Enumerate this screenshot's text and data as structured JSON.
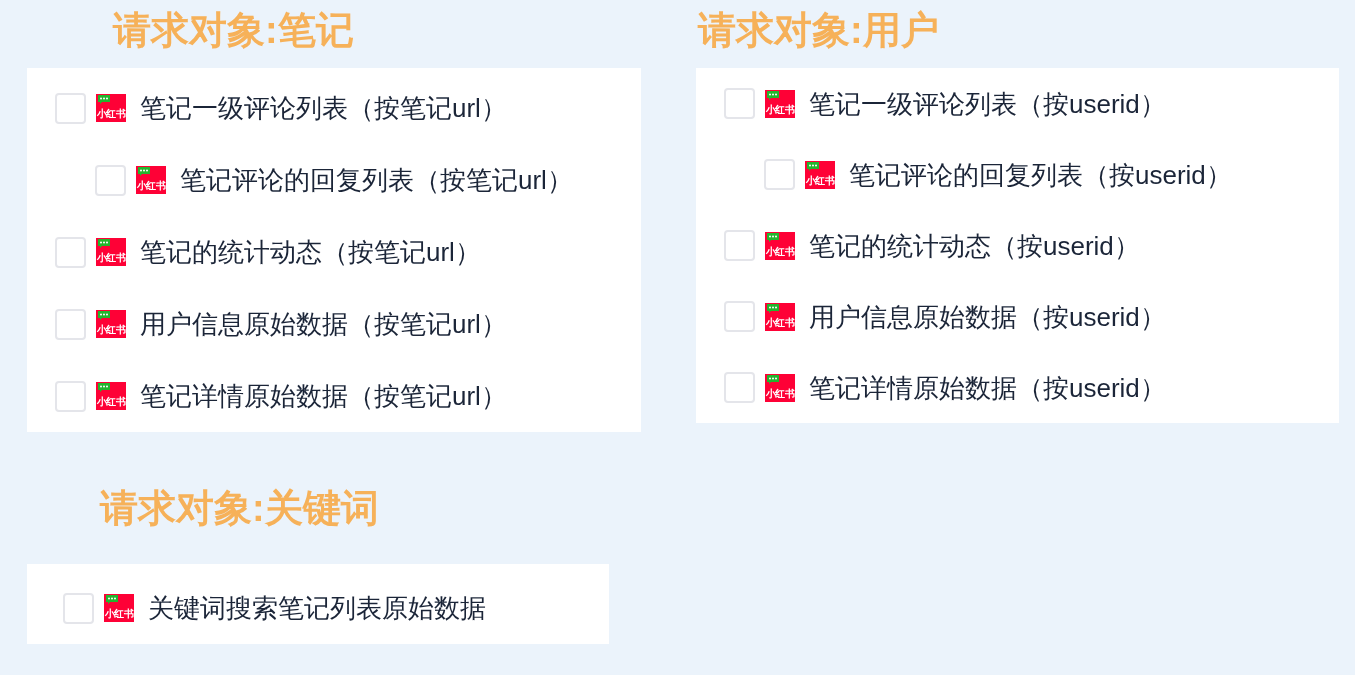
{
  "sections": [
    {
      "title": "请求对象:笔记",
      "items": [
        {
          "label": "笔记一级评论列表（按笔记url）",
          "checked": false,
          "logo_text": "小红书",
          "children": [
            {
              "label": "笔记评论的回复列表（按笔记url）",
              "checked": false,
              "logo_text": "小红书"
            }
          ]
        },
        {
          "label": "笔记的统计动态（按笔记url）",
          "checked": false,
          "logo_text": "小红书"
        },
        {
          "label": "用户信息原始数据（按笔记url）",
          "checked": false,
          "logo_text": "小红书"
        },
        {
          "label": "笔记详情原始数据（按笔记url）",
          "checked": false,
          "logo_text": "小红书"
        }
      ]
    },
    {
      "title": "请求对象:用户",
      "items": [
        {
          "label": "笔记一级评论列表（按userid）",
          "checked": false,
          "logo_text": "小红书",
          "children": [
            {
              "label": "笔记评论的回复列表（按userid）",
              "checked": false,
              "logo_text": "小红书"
            }
          ]
        },
        {
          "label": "笔记的统计动态（按userid）",
          "checked": false,
          "logo_text": "小红书"
        },
        {
          "label": "用户信息原始数据（按userid）",
          "checked": false,
          "logo_text": "小红书"
        },
        {
          "label": "笔记详情原始数据（按userid）",
          "checked": false,
          "logo_text": "小红书"
        }
      ]
    },
    {
      "title": "请求对象:关键词",
      "items": [
        {
          "label": "关键词搜索笔记列表原始数据",
          "checked": false,
          "logo_text": "小红书"
        }
      ]
    }
  ]
}
